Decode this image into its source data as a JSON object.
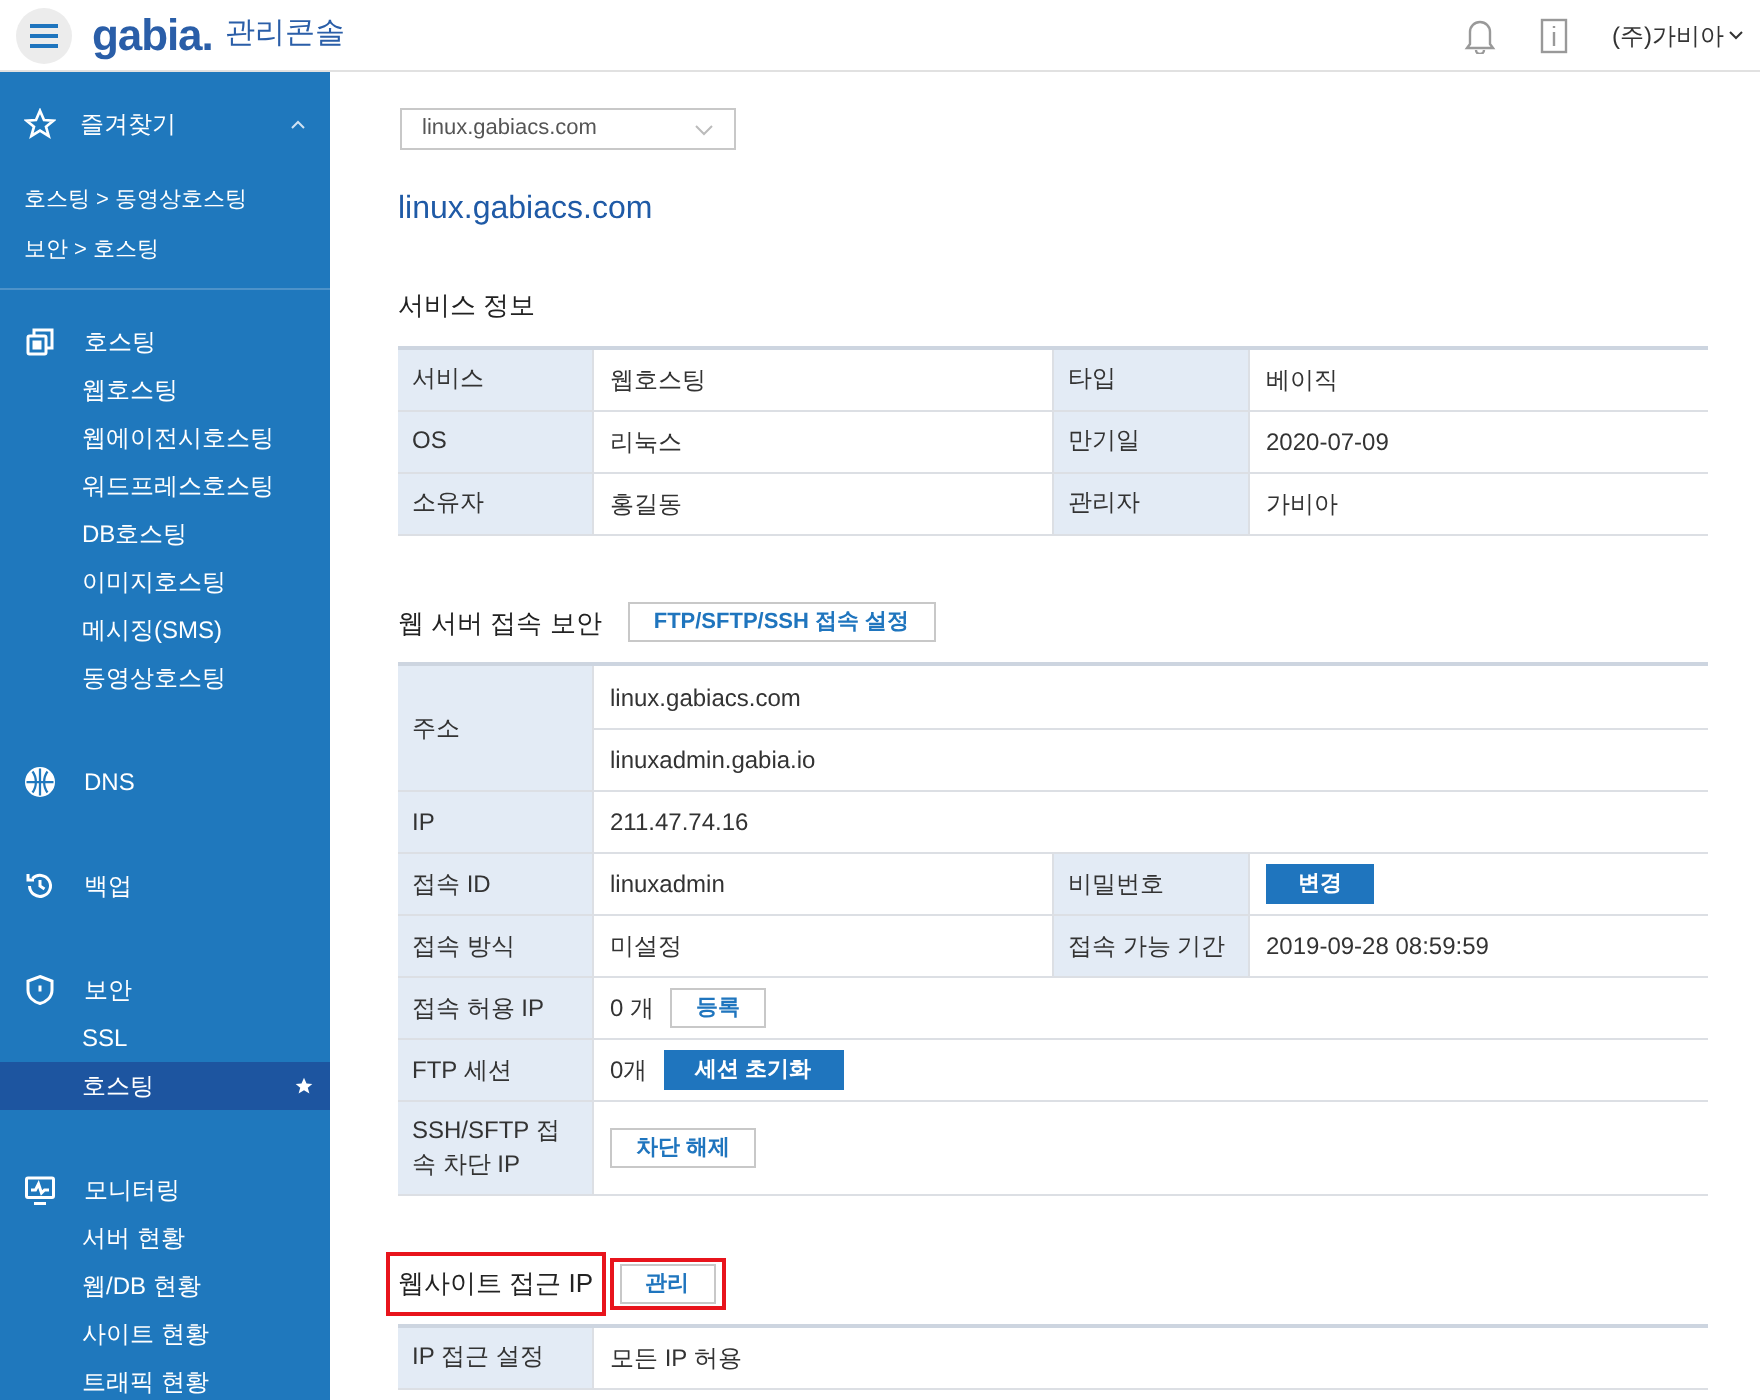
{
  "header": {
    "logo": "gabia.",
    "title": "관리콘솔",
    "account": "(주)가비아"
  },
  "sidebar": {
    "favorites": {
      "label": "즐겨찾기",
      "expanded": true,
      "items": [
        {
          "label": "호스팅 > 동영상호스팅"
        },
        {
          "label": "보안 > 호스팅"
        }
      ]
    },
    "groups": [
      {
        "label": "호스팅",
        "items": [
          {
            "label": "웹호스팅",
            "selected": false,
            "starred": false
          },
          {
            "label": "웹에이전시호스팅",
            "selected": false,
            "starred": false
          },
          {
            "label": "워드프레스호스팅",
            "selected": false,
            "starred": false
          },
          {
            "label": "DB호스팅",
            "selected": false,
            "starred": false
          },
          {
            "label": "이미지호스팅",
            "selected": false,
            "starred": false
          },
          {
            "label": "메시징(SMS)",
            "selected": false,
            "starred": false
          },
          {
            "label": "동영상호스팅",
            "selected": false,
            "starred": false
          }
        ]
      },
      {
        "label": "DNS"
      },
      {
        "label": "백업"
      },
      {
        "label": "보안",
        "items": [
          {
            "label": "SSL",
            "selected": false,
            "starred": false
          },
          {
            "label": "호스팅",
            "selected": true,
            "starred": true
          }
        ]
      },
      {
        "label": "모니터링",
        "items": [
          {
            "label": "서버 현황",
            "selected": false,
            "starred": false
          },
          {
            "label": "웹/DB 현황",
            "selected": false,
            "starred": false
          },
          {
            "label": "사이트 현황",
            "selected": false,
            "starred": false
          },
          {
            "label": "트래픽 현황",
            "selected": false,
            "starred": false
          }
        ]
      }
    ]
  },
  "domain_select": {
    "value": "linux.gabiacs.com"
  },
  "page_title": "linux.gabiacs.com",
  "sections": [
    {
      "title": "서비스 정보",
      "highlighted": false,
      "rows": [
        {
          "cells": [
            {
              "kind": "label",
              "text": "서비스"
            },
            {
              "kind": "value",
              "lines": [
                "웹호스팅"
              ]
            },
            {
              "kind": "label",
              "text": "타입"
            },
            {
              "kind": "value",
              "lines": [
                "베이직"
              ]
            }
          ]
        },
        {
          "cells": [
            {
              "kind": "label",
              "text": "OS"
            },
            {
              "kind": "value",
              "lines": [
                "리눅스"
              ]
            },
            {
              "kind": "label",
              "text": "만기일"
            },
            {
              "kind": "value",
              "lines": [
                "2020-07-09"
              ]
            }
          ]
        },
        {
          "cells": [
            {
              "kind": "label",
              "text": "소유자"
            },
            {
              "kind": "value",
              "lines": [
                "홍길동"
              ]
            },
            {
              "kind": "label",
              "text": "관리자"
            },
            {
              "kind": "value",
              "lines": [
                "가비아"
              ]
            }
          ]
        }
      ]
    },
    {
      "title": "웹 서버 접속 보안",
      "highlighted": false,
      "button": {
        "label": "FTP/SFTP/SSH 접속 설정",
        "kind": "secondary",
        "highlighted": false
      },
      "rows": [
        {
          "cells": [
            {
              "kind": "label",
              "text": "주소"
            },
            {
              "kind": "value",
              "lines": [
                "linux.gabiacs.com",
                "linuxadmin.gabia.io"
              ]
            }
          ]
        },
        {
          "cells": [
            {
              "kind": "label",
              "text": "IP"
            },
            {
              "kind": "value",
              "lines": [
                "211.47.74.16"
              ]
            }
          ]
        },
        {
          "cells": [
            {
              "kind": "label",
              "text": "접속 ID"
            },
            {
              "kind": "value",
              "lines": [
                "linuxadmin"
              ]
            },
            {
              "kind": "label",
              "text": "비밀번호"
            },
            {
              "kind": "value",
              "button": {
                "label": "변경",
                "kind": "primary"
              }
            }
          ]
        },
        {
          "cells": [
            {
              "kind": "label",
              "text": "접속 방식"
            },
            {
              "kind": "value",
              "lines": [
                "미설정"
              ]
            },
            {
              "kind": "label",
              "text": "접속 가능 기간"
            },
            {
              "kind": "value",
              "lines": [
                "2019-09-28 08:59:59"
              ]
            }
          ]
        },
        {
          "cells": [
            {
              "kind": "label",
              "text": "접속 허용 IP"
            },
            {
              "kind": "value",
              "lines": [
                "0 개"
              ],
              "button": {
                "label": "등록",
                "kind": "secondary"
              }
            }
          ]
        },
        {
          "cells": [
            {
              "kind": "label",
              "text": "FTP 세션"
            },
            {
              "kind": "value",
              "lines": [
                "0개"
              ],
              "button": {
                "label": "세션 초기화",
                "kind": "primary"
              }
            }
          ]
        },
        {
          "cells": [
            {
              "kind": "label",
              "text": "SSH/SFTP 접속 차단 IP"
            },
            {
              "kind": "value",
              "button": {
                "label": "차단 해제",
                "kind": "secondary"
              }
            }
          ]
        }
      ]
    },
    {
      "title": "웹사이트 접근 IP",
      "highlighted": true,
      "button": {
        "label": "관리",
        "kind": "secondary",
        "highlighted": true
      },
      "rows": [
        {
          "cells": [
            {
              "kind": "label",
              "text": "IP 접근 설정"
            },
            {
              "kind": "value",
              "lines": [
                "모든 IP 허용"
              ]
            }
          ]
        }
      ]
    }
  ]
}
